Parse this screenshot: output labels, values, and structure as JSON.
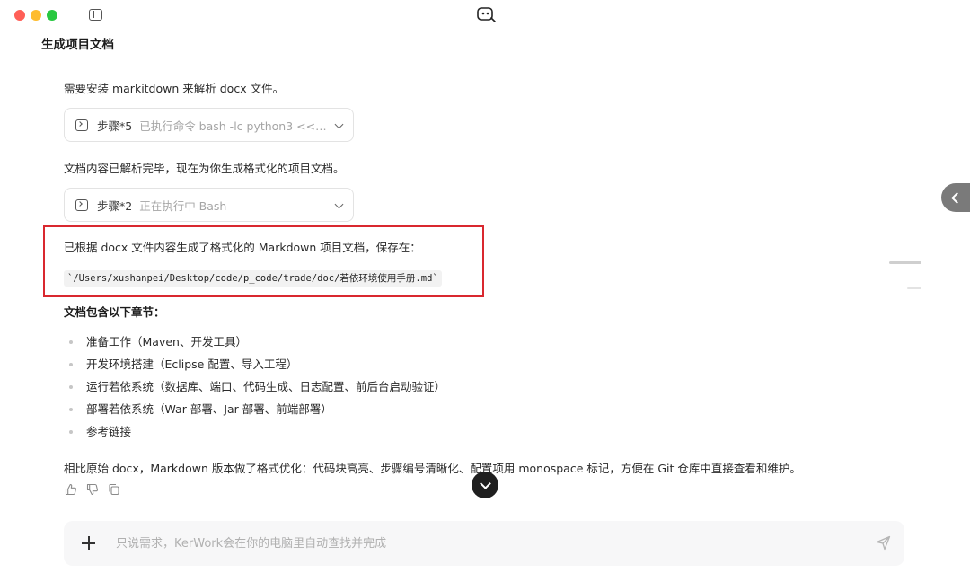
{
  "page": {
    "title": "生成项目文档"
  },
  "messages": {
    "intro": "需要安装 markitdown 来解析 docx 文件。",
    "step1": {
      "label": "步骤*5",
      "status": "已执行命令 bash -lc python3 << 'E..."
    },
    "parsed": "文档内容已解析完毕，现在为你生成格式化的项目文档。",
    "step2": {
      "label": "步骤*2",
      "status": "正在执行中 Bash"
    },
    "generated": "已根据 docx 文件内容生成了格式化的 Markdown 项目文档，保存在：",
    "file_path": "`/Users/xushanpei/Desktop/code/p_code/trade/doc/若依环境使用手册.md`",
    "sections_heading": "文档包含以下章节：",
    "sections": [
      "准备工作（Maven、开发工具）",
      "开发环境搭建（Eclipse 配置、导入工程）",
      "运行若依系统（数据库、端口、代码生成、日志配置、前后台启动验证）",
      "部署若依系统（War 部署、Jar 部署、前端部署）",
      "参考链接"
    ],
    "summary": "相比原始 docx，Markdown 版本做了格式优化：代码块高亮、步骤编号清晰化、配置项用 monospace 标记，方便在 Git 仓库中直接查看和维护。"
  },
  "icons": {
    "sidebar_toggle": "sidebar-toggle-icon",
    "logo": "app-logo-icon",
    "terminal": "terminal-icon",
    "thumbs_up": "thumbs-up-icon",
    "thumbs_down": "thumbs-down-icon",
    "copy": "copy-icon",
    "send": "send-icon"
  },
  "input": {
    "placeholder": "只说需求，KerWork会在你的电脑里自动查找并完成"
  },
  "colors": {
    "highlight_border": "#d9282f",
    "scroll_button": "#1f1f1f",
    "side_tab": "#7a7a7a"
  }
}
